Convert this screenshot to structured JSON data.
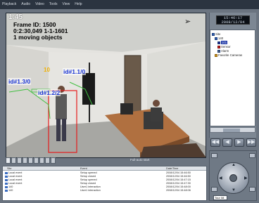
{
  "menu": [
    "Playback",
    "Audio",
    "Video",
    "Tools",
    "View",
    "Help"
  ],
  "video": {
    "camera_time": "1:45",
    "overlay_lines": [
      "Frame ID: 1500",
      "0:2:30,049 1-1-1601",
      "1 moving objects"
    ],
    "object_count": "10",
    "tracks": [
      "id#1.1/0",
      "id#1.3/0",
      "id#1.2/2"
    ]
  },
  "seek": {
    "progress": 0.0,
    "thumb_label": "Full-auto start"
  },
  "clock": {
    "time": "15:46:17",
    "date": "2008/12/04"
  },
  "tree": {
    "items": [
      "Site",
      "140",
      "101",
      "Sensor",
      "Alarm",
      "Favorite Cameras"
    ]
  },
  "controls": [
    "◀◀",
    "◀",
    "▶",
    "▶▶"
  ],
  "log": {
    "columns": [
      "Site",
      "Event",
      "Date/Time"
    ],
    "rows": [
      [
        "Local event",
        "Setup opened",
        "2008/12/04 15:46:50"
      ],
      [
        "Local event",
        "Setup closed",
        "2008/12/04 15:46:50"
      ],
      [
        "Local event",
        "Setup opened",
        "2008/12/04 15:47:15"
      ],
      [
        "Local event",
        "Setup closed",
        "2008/12/04 15:47:30"
      ],
      [
        "140",
        "User1 interaction",
        "2008/12/04 15:48:00"
      ],
      [
        "140",
        "User1 interaction",
        "2008/12/04 15:48:06"
      ]
    ]
  },
  "ptz": {
    "tour_label": "Tour 08"
  }
}
